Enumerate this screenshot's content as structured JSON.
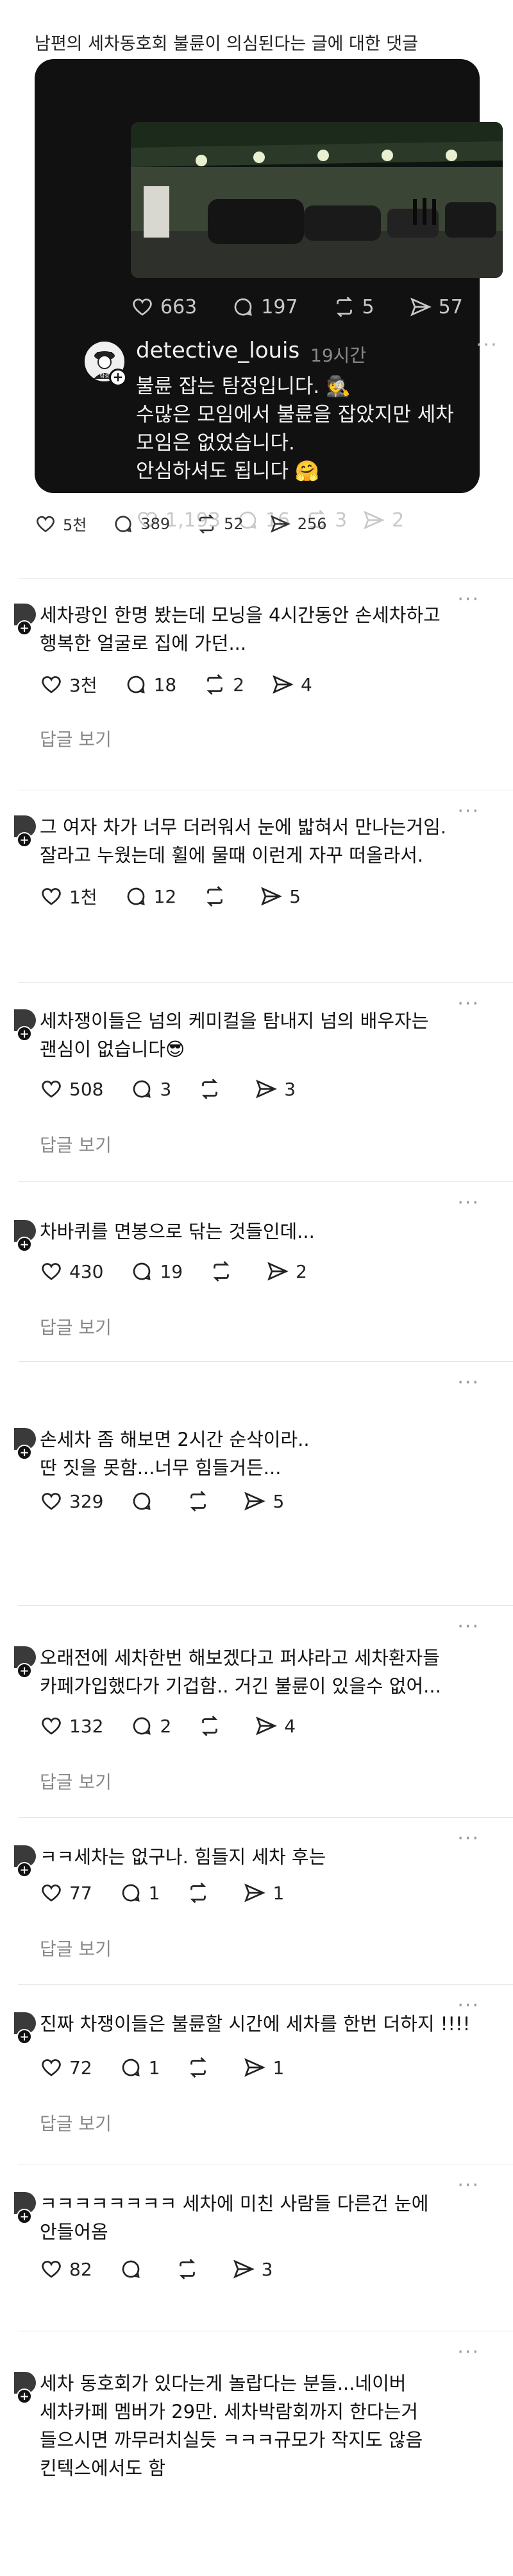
{
  "header": "남편의 세차동호회 불륜이 의심된다는 글에 대한 댓글",
  "embedded_post": {
    "photo_alt": "parking-lot-night-photo",
    "stats": {
      "likes": "663",
      "comments": "197",
      "reposts": "5",
      "shares": "57"
    },
    "reply": {
      "username": "detective_louis",
      "time": "19시간",
      "lines": [
        "불륜 잡는 탐정입니다. 🕵️",
        "수많은 모임에서 불륜을 잡았지만 세차",
        "모임은 없었습니다.",
        "안심하셔도 됩니다 🤗"
      ],
      "stats": {
        "likes": "1,193",
        "comments": "16",
        "reposts": "3",
        "shares": "2"
      }
    }
  },
  "post_stats": {
    "likes": "5천",
    "comments": "389",
    "reposts": "52",
    "shares": "256"
  },
  "reply_label": "답글 보기",
  "comments": [
    {
      "lines": [
        "세차광인 한명 봤는데 모닝을 4시간동안 손세차하고",
        "행복한 얼굴로 집에 가던..."
      ],
      "likes": "3천",
      "comments": "18",
      "reposts": "2",
      "shares": "4"
    },
    {
      "lines": [
        "그 여자 차가 너무 더러워서 눈에 밟혀서 만나는거임.",
        "잘라고 누웠는데 휠에 물때 이런게 자꾸 떠올라서."
      ],
      "likes": "1천",
      "comments": "12",
      "reposts": "",
      "shares": "5"
    },
    {
      "lines": [
        "세차쟁이들은 넘의 케미컬을 탐내지 넘의 배우자는",
        "괜심이 없습니다😎"
      ],
      "likes": "508",
      "comments": "3",
      "reposts": "",
      "shares": "3"
    },
    {
      "lines": [
        "차바퀴를 면봉으로 닦는 것들인데..."
      ],
      "likes": "430",
      "comments": "19",
      "reposts": "",
      "shares": "2"
    },
    {
      "lines": [
        "손세차 좀 해보면 2시간 순삭이라..",
        "딴 짓을 못함...너무 힘들거든..."
      ],
      "likes": "329",
      "comments": "",
      "reposts": "",
      "shares": "5"
    },
    {
      "lines": [
        "오래전에 세차한번 해보겠다고 퍼샤라고 세차환자들",
        "카페가입했다가 기겁함.. 거긴 불륜이 있을수 없어..."
      ],
      "likes": "132",
      "comments": "2",
      "reposts": "",
      "shares": "4"
    },
    {
      "lines": [
        "ㅋㅋ세차는 없구나. 힘들지 세차 후는"
      ],
      "likes": "77",
      "comments": "1",
      "reposts": "",
      "shares": "1"
    },
    {
      "lines": [
        "진짜 차쟁이들은 불륜할 시간에 세차를 한번 더하지 !!!!"
      ],
      "likes": "72",
      "comments": "1",
      "reposts": "",
      "shares": "1"
    },
    {
      "lines": [
        "ㅋㅋㅋㅋㅋㅋㅋㅋ 세차에 미친 사람들 다른건 눈에",
        "안들어옴"
      ],
      "likes": "82",
      "comments": "",
      "reposts": "",
      "shares": "3"
    },
    {
      "lines": [
        "세차 동호회가 있다는게 놀랍다는 분들...네이버",
        "세차카페 멤버가 29만. 세차박람회까지 한다는거",
        "들으시면 까무러치실듯 ㅋㅋㅋ규모가 작지도 않음",
        "킨텍스에서도 함"
      ]
    }
  ]
}
